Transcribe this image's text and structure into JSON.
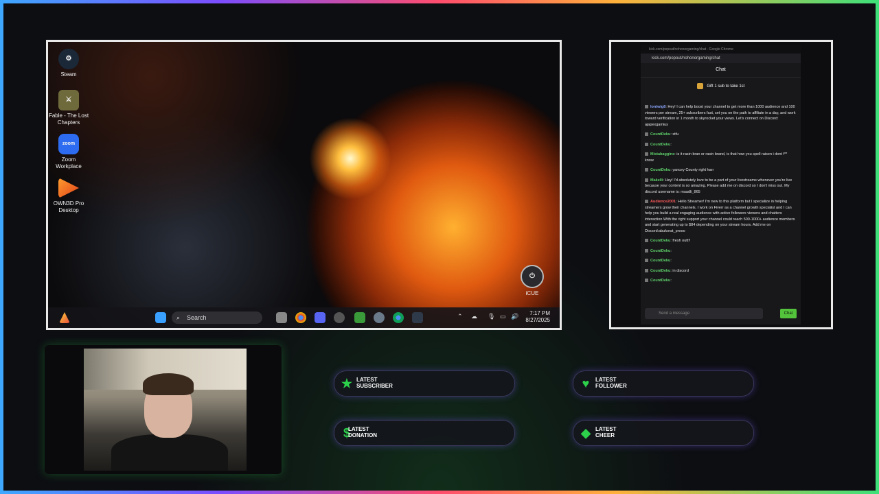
{
  "desktop": {
    "icons": [
      {
        "label": "Steam",
        "icon": "steam-icon"
      },
      {
        "label": "Fable - The Lost Chapters",
        "icon": "fable-icon"
      },
      {
        "label": "Zoom Workplace",
        "icon": "zoom-icon"
      },
      {
        "label": "OWN3D Pro Desktop",
        "icon": "own3d-icon"
      }
    ],
    "zoom_text": "zoom",
    "icue_label": "iCUE",
    "taskbar": {
      "search_placeholder": "Search",
      "time": "7:17 PM",
      "date": "8/27/2025"
    }
  },
  "chat": {
    "window_title": "kick.com/popout/nohonorgaming/chat - Google Chrome",
    "url": "kick.com/popout/nohonorgaming/chat",
    "header": "Chat",
    "gift_text": "Gift 1 sub to take 1st",
    "input_placeholder": "Send a message",
    "send_label": "Chat",
    "messages": [
      {
        "user": "lontwig8",
        "color": "u-b",
        "text": "Hey! I can help boost your channel to get more than 1000 audience and 100 viewers per stream, 25+ subscribers fast, set you on the path to affiliate in a day, and work toward verification in 1 month to skyrocket your views. Let's connect on Discord: ajapexgamius"
      },
      {
        "user": "CountDeku",
        "color": "u-g",
        "text": "stfu"
      },
      {
        "user": "CountDeku",
        "color": "u-g",
        "text": ""
      },
      {
        "user": "Mistabaggins",
        "color": "u-g",
        "text": "is it rasin bran or rasin brand, is that how you spell raisen i dont f** know"
      },
      {
        "user": "CountDeku",
        "color": "u-g",
        "text": "yancey County right harr"
      },
      {
        "user": "Makelli",
        "color": "u-g",
        "text": "Hey! I'd absolutely love to be a part of your livestreams whenever you're live because your content is so amazing. Please add me on discord so I don't miss out. My discord username is: muadli_865"
      },
      {
        "user": "Audience2001",
        "color": "u-r",
        "text": "Hello Streamer! I'm new to this platform but I specialize in helping streamers grow their channels. I work on Fiverr as a channel growth specialist and I can help you build a real engaging audience with active followers viewers and chatters interaction With the right support your channel could reach 500-1000+ audience members and start generating up to $84 depending on your stream hours. Add me on Discord:abukorat_prooo"
      },
      {
        "user": "CountDeku",
        "color": "u-g",
        "text": "fresh outt!!"
      },
      {
        "user": "CountDeku",
        "color": "u-g",
        "text": ""
      },
      {
        "user": "CountDeku",
        "color": "u-g",
        "text": ""
      },
      {
        "user": "CountDeku",
        "color": "u-g",
        "text": "in discord"
      },
      {
        "user": "CountDeku",
        "color": "u-g",
        "text": ""
      }
    ]
  },
  "alerts": {
    "subscriber": "LATEST SUBSCRIBER",
    "follower": "LATEST FOLLOWER",
    "donation": "LATEST DONATION",
    "cheer": "LATEST CHEER"
  },
  "colors": {
    "accent_green": "#2cd04a",
    "kick_green": "#53c33b"
  }
}
